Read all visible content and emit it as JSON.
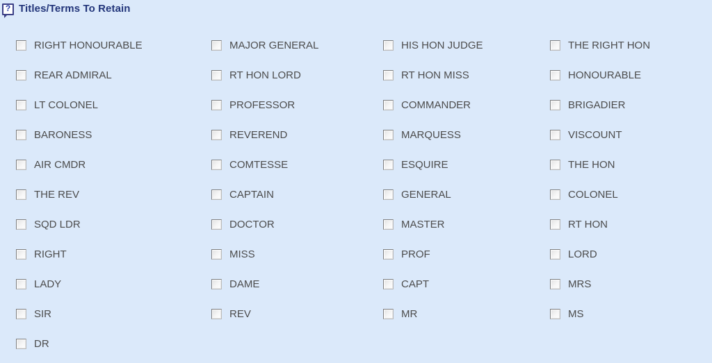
{
  "panel": {
    "title": "Titles/Terms To Retain",
    "help_icon": "help-question-icon",
    "help_glyph": "?",
    "background_color": "#dbe9fa",
    "title_color": "#22357a",
    "label_color": "#4c4c4c"
  },
  "grid": {
    "columns": 4,
    "rows": 11,
    "total_options": 45,
    "all_unchecked": true,
    "options": [
      [
        {
          "label": "RIGHT HONOURABLE",
          "checked": false
        },
        {
          "label": "MAJOR GENERAL",
          "checked": false
        },
        {
          "label": "HIS HON JUDGE",
          "checked": false
        },
        {
          "label": "THE RIGHT HON",
          "checked": false
        }
      ],
      [
        {
          "label": "REAR ADMIRAL",
          "checked": false
        },
        {
          "label": "RT HON LORD",
          "checked": false
        },
        {
          "label": "RT HON MISS",
          "checked": false
        },
        {
          "label": "HONOURABLE",
          "checked": false
        }
      ],
      [
        {
          "label": "LT COLONEL",
          "checked": false
        },
        {
          "label": "PROFESSOR",
          "checked": false
        },
        {
          "label": "COMMANDER",
          "checked": false
        },
        {
          "label": "BRIGADIER",
          "checked": false
        }
      ],
      [
        {
          "label": "BARONESS",
          "checked": false
        },
        {
          "label": "REVEREND",
          "checked": false
        },
        {
          "label": "MARQUESS",
          "checked": false
        },
        {
          "label": "VISCOUNT",
          "checked": false
        }
      ],
      [
        {
          "label": "AIR CMDR",
          "checked": false
        },
        {
          "label": "COMTESSE",
          "checked": false
        },
        {
          "label": "ESQUIRE",
          "checked": false
        },
        {
          "label": "THE HON",
          "checked": false
        }
      ],
      [
        {
          "label": "THE REV",
          "checked": false
        },
        {
          "label": "CAPTAIN",
          "checked": false
        },
        {
          "label": "GENERAL",
          "checked": false
        },
        {
          "label": "COLONEL",
          "checked": false
        }
      ],
      [
        {
          "label": "SQD LDR",
          "checked": false
        },
        {
          "label": "DOCTOR",
          "checked": false
        },
        {
          "label": "MASTER",
          "checked": false
        },
        {
          "label": "RT HON",
          "checked": false
        }
      ],
      [
        {
          "label": "RIGHT",
          "checked": false
        },
        {
          "label": "MISS",
          "checked": false
        },
        {
          "label": "PROF",
          "checked": false
        },
        {
          "label": "LORD",
          "checked": false
        }
      ],
      [
        {
          "label": "LADY",
          "checked": false
        },
        {
          "label": "DAME",
          "checked": false
        },
        {
          "label": "CAPT",
          "checked": false
        },
        {
          "label": "MRS",
          "checked": false
        }
      ],
      [
        {
          "label": "SIR",
          "checked": false
        },
        {
          "label": "REV",
          "checked": false
        },
        {
          "label": "MR",
          "checked": false
        },
        {
          "label": "MS",
          "checked": false
        }
      ],
      [
        {
          "label": "DR",
          "checked": false
        }
      ]
    ]
  }
}
